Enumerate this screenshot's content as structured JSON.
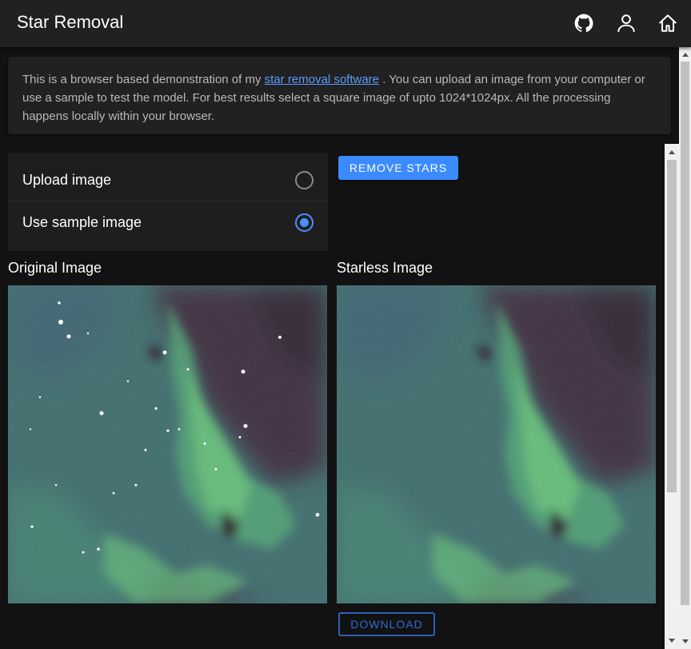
{
  "header": {
    "title": "Star Removal",
    "icons": [
      "github-icon",
      "user-icon",
      "home-icon"
    ]
  },
  "info": {
    "text_before": "This is a browser based demonstration of my ",
    "link_text": "star removal software",
    "text_after": " . You can upload an image from your computer or use a sample to test the model. For best results select a square image of upto 1024*1024px. All the processing happens locally within your browser."
  },
  "source": {
    "options": [
      {
        "label": "Upload image",
        "selected": false
      },
      {
        "label": "Use sample image",
        "selected": true
      }
    ]
  },
  "actions": {
    "remove_label": "REMOVE STARS",
    "download_label": "DOWNLOAD"
  },
  "images": {
    "original_title": "Original Image",
    "starless_title": "Starless Image"
  },
  "colors": {
    "accent": "#3b8bff",
    "background": "#121212",
    "appbar": "#212121",
    "card": "#212121"
  }
}
